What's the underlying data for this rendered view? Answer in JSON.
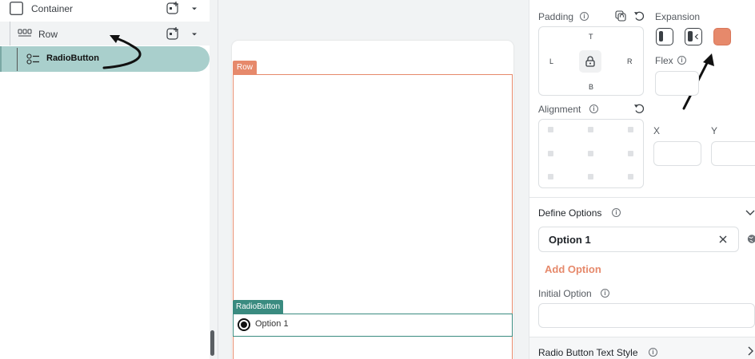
{
  "tree": {
    "items": [
      {
        "label": "Container",
        "icon": "container-icon"
      },
      {
        "label": "Row",
        "icon": "row-icon"
      },
      {
        "label": "RadioButton",
        "icon": "radio-button-icon"
      }
    ]
  },
  "canvas": {
    "row_tag": "Row",
    "radio_tag": "RadioButton",
    "radio_option": "Option 1"
  },
  "props": {
    "padding_label": "Padding",
    "expansion_label": "Expansion",
    "padding_sides": {
      "top": "T",
      "left": "L",
      "right": "R",
      "bottom": "B"
    },
    "flex_label": "Flex",
    "alignment_label": "Alignment",
    "x_label": "X",
    "y_label": "Y",
    "define_options_label": "Define Options",
    "option_value": "Option 1",
    "add_option_label": "Add Option",
    "initial_option_label": "Initial Option",
    "text_style_label": "Radio Button Text Style"
  },
  "colors": {
    "accent": "#e6896b",
    "selection": "#a9cfcc",
    "radio_accent": "#3a8b80"
  }
}
